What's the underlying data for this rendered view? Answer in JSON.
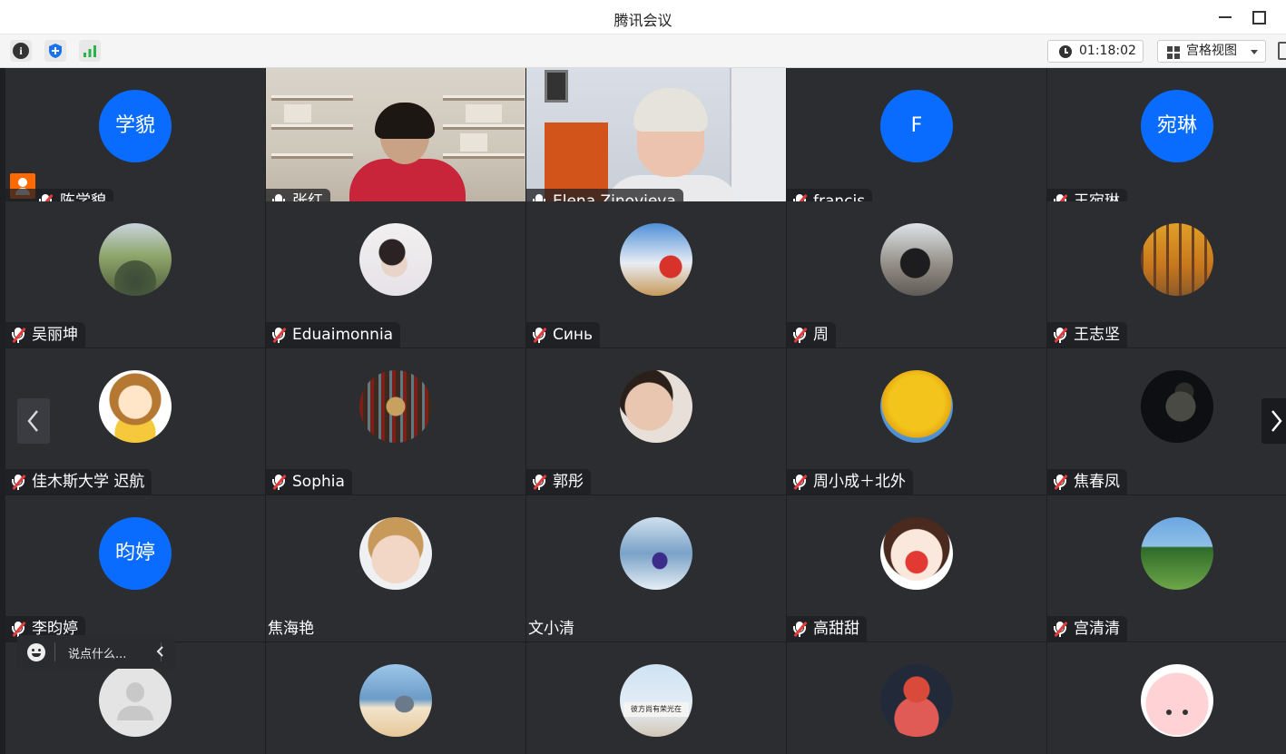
{
  "window": {
    "title": "腾讯会议"
  },
  "toolbar": {
    "timer": "01:18:02",
    "view_label": "宫格视图"
  },
  "colors": {
    "avatar_blue": "#0a6cff",
    "host_orange": "#ff6a00",
    "muted_red": "#e23b3b",
    "speaking_green": "#3ac45a"
  },
  "tiles": [
    {
      "name": "陈学貌",
      "avatar_text": "学貌",
      "mic": "muted",
      "host": true
    },
    {
      "name": "张红",
      "mic": "on",
      "video": true
    },
    {
      "name": "Elena Zinovieva",
      "mic": "on",
      "video": true
    },
    {
      "name": "francis",
      "avatar_text": "F",
      "mic": "muted"
    },
    {
      "name": "王宛琳",
      "avatar_text": "宛琳",
      "mic": "muted"
    },
    {
      "name": "吴丽坤",
      "mic": "muted",
      "avatar_icon": "lake-photo"
    },
    {
      "name": "Eduaimonnia",
      "mic": "muted",
      "avatar_icon": "girl-photo"
    },
    {
      "name": "Синь",
      "mic": "muted",
      "avatar_icon": "sky-photo"
    },
    {
      "name": "周",
      "mic": "muted",
      "avatar_icon": "street-photo"
    },
    {
      "name": "王志坚",
      "mic": "muted",
      "avatar_icon": "forest-photo"
    },
    {
      "name": "佳木斯大学 迟航",
      "mic": "muted",
      "avatar_icon": "cartoon-photo"
    },
    {
      "name": "Sophia",
      "mic": "muted",
      "avatar_icon": "temple-photo"
    },
    {
      "name": "郭彤",
      "mic": "muted",
      "avatar_icon": "child-photo"
    },
    {
      "name": "周小成＋北外",
      "mic": "muted",
      "avatar_icon": "ginkgo-photo"
    },
    {
      "name": "焦春凤",
      "mic": "muted",
      "avatar_icon": "night-photo"
    },
    {
      "name": "李昀婷",
      "avatar_text": "昀婷",
      "mic": "muted"
    },
    {
      "name": "焦海艳",
      "mic": "none",
      "avatar_icon": "baby-photo"
    },
    {
      "name": "文小清",
      "mic": "none",
      "avatar_icon": "sea-photo"
    },
    {
      "name": "高甜甜",
      "mic": "muted",
      "avatar_icon": "cartoon-face-photo"
    },
    {
      "name": "宫清清",
      "mic": "muted",
      "avatar_icon": "field-photo"
    },
    {
      "name": "",
      "mic": "none",
      "avatar_icon": "default-user-photo"
    },
    {
      "name": "",
      "mic": "none",
      "avatar_icon": "beach-photo"
    },
    {
      "name": "",
      "mic": "none",
      "avatar_icon": "sign-photo",
      "sign_text": "彼方尚有荣光在"
    },
    {
      "name": "",
      "mic": "none",
      "avatar_icon": "kremlin-photo"
    },
    {
      "name": "",
      "mic": "none",
      "avatar_icon": "pink-cartoon-photo"
    }
  ],
  "chat": {
    "placeholder": "说点什么..."
  }
}
